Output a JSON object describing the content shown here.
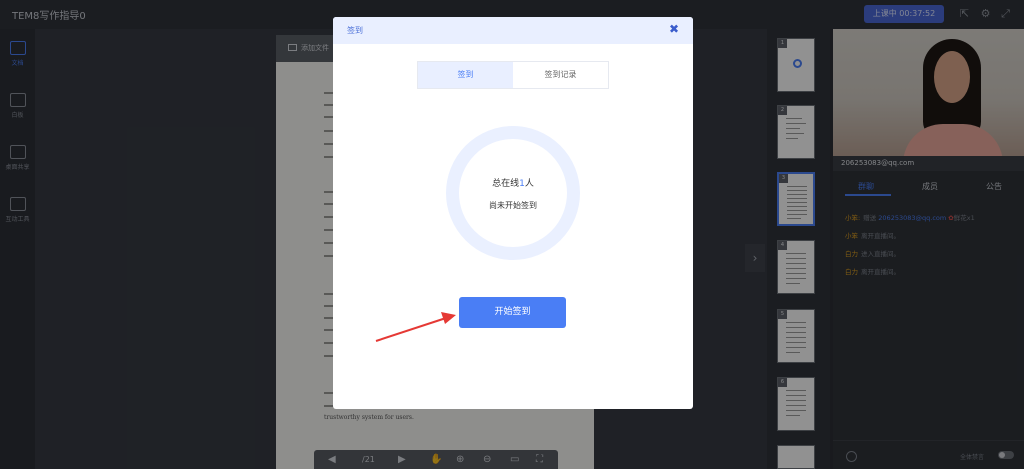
{
  "header": {
    "app_title": "TEM8写作指导0",
    "live_status": "上课中 00:37:52",
    "share_icon": "external-link-icon",
    "settings_icon": "gear-icon",
    "fullscreen_icon": "fullscreen-icon"
  },
  "sidebar": {
    "items": [
      {
        "label": "文档",
        "icon": "document-icon",
        "active": true
      },
      {
        "label": "白板",
        "icon": "whiteboard-icon",
        "active": false
      },
      {
        "label": "桌面共享",
        "icon": "monitor-icon",
        "active": false
      },
      {
        "label": "互动工具",
        "icon": "toolbox-icon",
        "active": false
      }
    ]
  },
  "document": {
    "add_file_label": "添加文件",
    "visible_text": "trustworthy system for users.",
    "page_indicator": "/21"
  },
  "thumbnails": {
    "numbers": [
      "1",
      "2",
      "3",
      "4",
      "5",
      "6"
    ],
    "active_index": 2
  },
  "right_panel": {
    "video_caption": "206253083@qq.com",
    "tabs": [
      "群聊",
      "成员",
      "公告"
    ],
    "active_tab": "群聊",
    "chat": [
      {
        "who": "小笨:",
        "text": "赠送",
        "email": "206253083@qq.com",
        "suffix": "鲜花x1"
      },
      {
        "who": "小笨",
        "text": "离开直播间。"
      },
      {
        "who": "白力",
        "text": "进入直播间。"
      },
      {
        "who": "白力",
        "text": "离开直播间。"
      }
    ],
    "mute_label": "全体禁言"
  },
  "modal": {
    "title": "签到",
    "close_icon": "close-icon",
    "tabs": [
      "签到",
      "签到记录"
    ],
    "active_tab": "签到",
    "online_prefix": "总在线",
    "online_count": "1",
    "online_suffix": "人",
    "status_text": "尚未开始签到",
    "start_button": "开始签到"
  },
  "colors": {
    "accent": "#4a7ef5",
    "modal_header": "#e9efff",
    "annotation_arrow": "#e53935"
  }
}
